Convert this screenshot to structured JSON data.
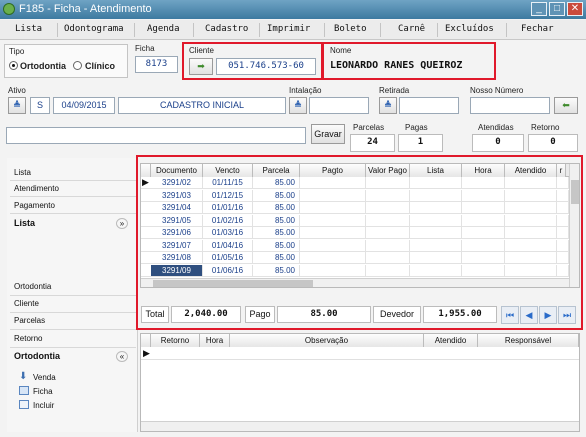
{
  "window": {
    "title": "F185 - Ficha - Atendimento",
    "minimize": "_",
    "maximize": "□",
    "close": "✕"
  },
  "menu": [
    "Lista",
    "Odontograma",
    "Agenda",
    "Cadastro",
    "Imprimir",
    "Boleto",
    "Carnê",
    "Excluídos",
    "Fechar"
  ],
  "form": {
    "tipo_label": "Tipo",
    "tipo_opt1": "Ortodontia",
    "tipo_opt2": "Clínico",
    "ficha_label": "Ficha",
    "ficha_value": "8173",
    "cliente_label": "Cliente",
    "cliente_value": "051.746.573-60",
    "nome_label": "Nome",
    "nome_value": "LEONARDO RANES QUEIROZ",
    "ativo_label": "Ativo",
    "ativo_flag": "S",
    "ativo_date": "04/09/2015",
    "ativo_desc": "CADASTRO INICIAL",
    "instalacao_label": "Intalação",
    "retirada_label": "Retirada",
    "nosso_numero_label": "Nosso Número",
    "gravar_label": "Gravar",
    "parcelas_label": "Parcelas",
    "parcelas_value": "24",
    "pagas_label": "Pagas",
    "pagas_value": "1",
    "atendidas_label": "Atendidas",
    "atendidas_value": "0",
    "retorno_label": "Retorno",
    "retorno_value": "0"
  },
  "sidebar": {
    "top_items": [
      "Lista",
      "Atendimento",
      "Pagamento"
    ],
    "lista_header": "Lista",
    "bottom_items": [
      "Ortodontia",
      "Cliente",
      "Parcelas",
      "Retorno"
    ],
    "ortodontia_header": "Ortodontia",
    "actions": [
      "Venda",
      "Ficha",
      "Incluir"
    ]
  },
  "parcelas_grid": {
    "columns": [
      "Documento",
      "Vencto",
      "Parcela",
      "Pagto",
      "Valor Pago",
      "Lista",
      "Hora",
      "Atendido",
      "r"
    ],
    "rows": [
      [
        "3291/02",
        "01/11/15",
        "85.00"
      ],
      [
        "3291/03",
        "01/12/15",
        "85.00"
      ],
      [
        "3291/04",
        "01/01/16",
        "85.00"
      ],
      [
        "3291/05",
        "01/02/16",
        "85.00"
      ],
      [
        "3291/06",
        "01/03/16",
        "85.00"
      ],
      [
        "3291/07",
        "01/04/16",
        "85.00"
      ],
      [
        "3291/08",
        "01/05/16",
        "85.00"
      ],
      [
        "3291/09",
        "01/06/16",
        "85.00"
      ]
    ]
  },
  "totals": {
    "total_label": "Total",
    "total_value": "2,040.00",
    "pago_label": "Pago",
    "pago_value": "85.00",
    "devedor_label": "Devedor",
    "devedor_value": "1,955.00"
  },
  "retorno_grid": {
    "columns": [
      "Retorno",
      "Hora",
      "Observação",
      "Atendido",
      "Responsável"
    ]
  },
  "colors": {
    "accent": "#e0192b",
    "titlebar": "#4a86ad",
    "selected_row": "#2f4f7f"
  }
}
